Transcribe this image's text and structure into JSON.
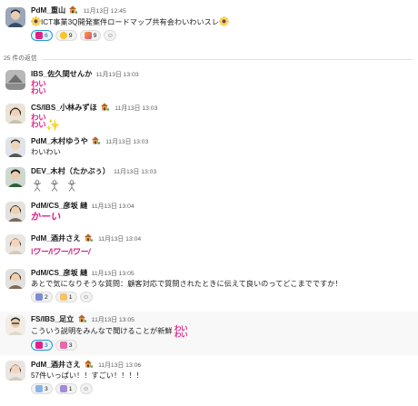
{
  "parent": {
    "name": "PdM_重山",
    "time": "11月13日 12:45",
    "text": "ICT事業3Q開発案件ロードマップ共有会わいわいスレ",
    "reactions": [
      {
        "emoji": "waiwai-icon",
        "count": "6",
        "mine": true
      },
      {
        "emoji": "sunflower-icon",
        "count": "9",
        "mine": false
      },
      {
        "emoji": "party-popper-icon",
        "count": "9",
        "mine": false
      }
    ]
  },
  "divider": {
    "label": "25 件の返信"
  },
  "replies": [
    {
      "name": "IBS_佐久間せんか",
      "time": "11月13日 13:03",
      "stamp": "わい\nわい"
    },
    {
      "name": "CS/IBS_小林みずほ",
      "time": "11月13日 13:03",
      "stamp": "わい\nわい",
      "sparkle": "✨"
    },
    {
      "name": "PdM_木村ゆうや",
      "time": "11月13日 13:03",
      "text": "わいわい"
    },
    {
      "name": "DEV_木村（たかぷぅ）",
      "time": "11月13日 13:03"
    },
    {
      "name": "PdM/CS_彦坂 縫",
      "time": "11月13日 13:04",
      "stamp": "かーい"
    },
    {
      "name": "PdM_酒井さえ",
      "time": "11月13日 13:04",
      "stamp": "\\ワー/\\ワー/\\ワー/"
    },
    {
      "name": "PdM/CS_彦坂 縫",
      "time": "11月13日 13:05",
      "text": "あとで気になりそうな質問：顧客対応で質問されたときに伝えて良いのってどこまでですか！",
      "reactions": [
        {
          "emoji": "sign-icon",
          "count": "2",
          "mine": false
        },
        {
          "emoji": "pray-icon",
          "count": "1",
          "mine": false
        }
      ]
    },
    {
      "name": "FS/IBS_足立",
      "time": "11月13日 13:05",
      "text": "こういう説明をみんなで聞けることが新鮮",
      "stamp": "わい\nわい",
      "reactions": [
        {
          "emoji": "waiwai-icon",
          "count": "3",
          "mine": true
        },
        {
          "emoji": "waiwai-icon",
          "count": "3",
          "mine": false
        }
      ]
    },
    {
      "name": "PdM_酒井さえ",
      "time": "11月13日 13:06",
      "text": "57件いっぱい！！すごい！！！！",
      "reactions": [
        {
          "emoji": "sign-icon",
          "count": "3",
          "mine": false
        },
        {
          "emoji": "sign-icon",
          "count": "1",
          "mine": false
        }
      ]
    }
  ],
  "colors": {
    "accent": "#1264a3",
    "stamp_pink": "#e0218a",
    "add_reaction_icon": "add-reaction-icon",
    "house_icon": "house-with-garden-icon"
  }
}
